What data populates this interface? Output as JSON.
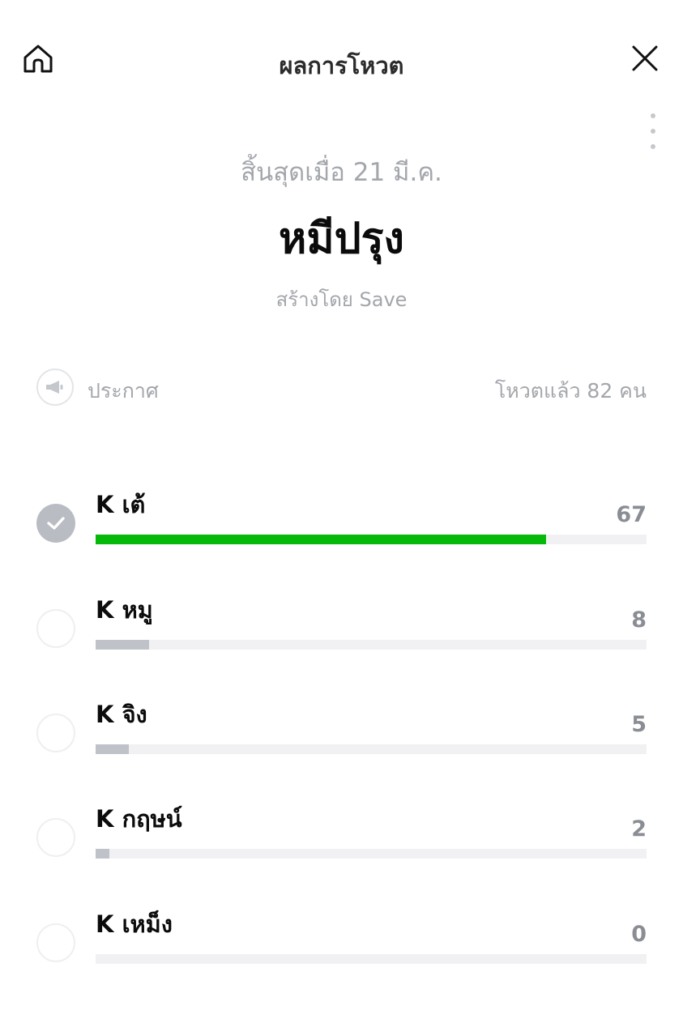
{
  "header": {
    "title": "ผลการโหวต",
    "home_icon": "home-icon",
    "close_icon": "close-icon",
    "more_icon": "more-vertical-icon"
  },
  "poll": {
    "ended_text": "สิ้นสุดเมื่อ 21 มี.ค.",
    "title": "หมีปรุง",
    "created_by": "สร้างโดย Save",
    "announce_label": "ประกาศ",
    "announce_icon": "megaphone-icon",
    "vote_summary": "โหวตแล้ว 82 คน",
    "total_votes": 82
  },
  "colors": {
    "winner_bar": "#06b908",
    "other_bar": "#bfc2c8",
    "track": "#f1f1f3",
    "muted_text": "#a3a6ab"
  },
  "options": [
    {
      "label": "K เต้",
      "count": "67",
      "votes": 67,
      "selected": true
    },
    {
      "label": "K หมู",
      "count": "8",
      "votes": 8,
      "selected": false
    },
    {
      "label": "K จิง",
      "count": "5",
      "votes": 5,
      "selected": false
    },
    {
      "label": "K กฤษน์",
      "count": "2",
      "votes": 2,
      "selected": false
    },
    {
      "label": "K เหม็ง",
      "count": "0",
      "votes": 0,
      "selected": false
    }
  ]
}
